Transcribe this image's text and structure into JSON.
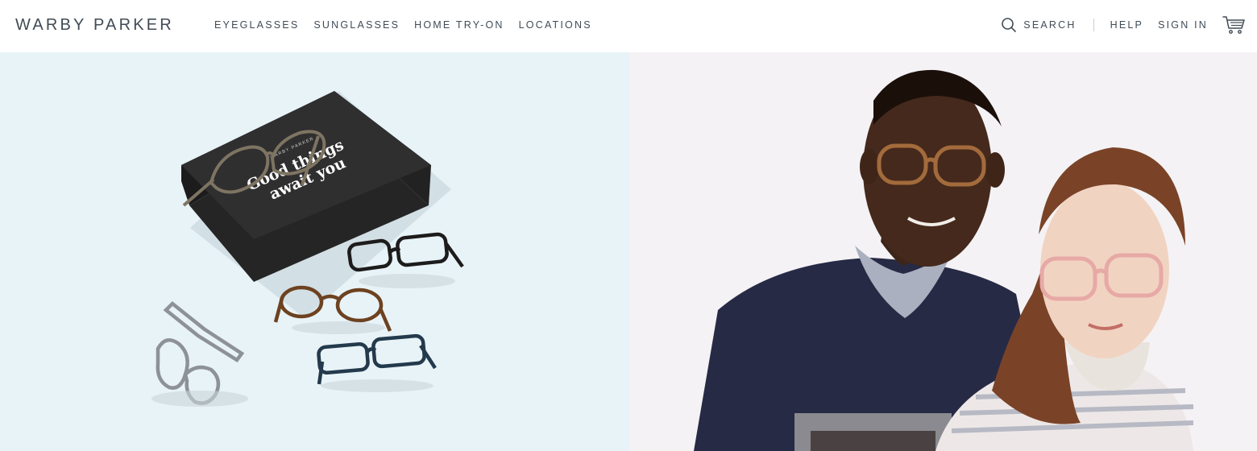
{
  "header": {
    "logo": "WARBY PARKER",
    "nav": [
      "EYEGLASSES",
      "SUNGLASSES",
      "HOME TRY-ON",
      "LOCATIONS"
    ],
    "search_label": "SEARCH",
    "help_label": "HELP",
    "signin_label": "SIGN IN",
    "icons": {
      "search": "search-icon",
      "cart": "cart-icon"
    }
  },
  "hero": {
    "box_brand": "WARBY PARKER",
    "box_text_line1": "Good things",
    "box_text_line2": "await you"
  },
  "colors": {
    "text": "#414b56",
    "left_bg": "#e8f3f7",
    "right_bg": "#f4f2f4",
    "box": "#2b2b2c"
  }
}
